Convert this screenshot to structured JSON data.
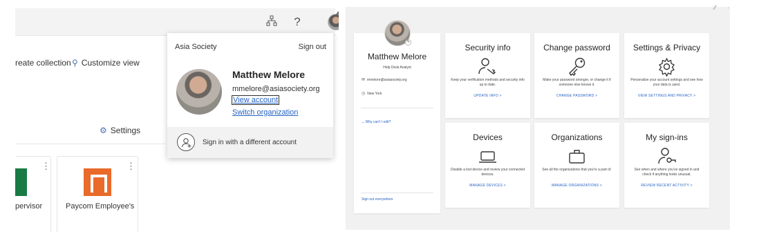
{
  "left_panel": {
    "toolbar": {
      "org_chart_icon": "org-chart-icon",
      "help_icon": "?",
      "avatar_icon": "avatar"
    },
    "actions": {
      "create_collection": "reate collection",
      "customize_view": "Customize view",
      "settings": "Settings"
    },
    "apps": [
      {
        "name": "pervisor",
        "icon": "green-app-icon",
        "color": "#1a7a43"
      },
      {
        "name": "Paycom Employee's",
        "icon": "paycom-icon",
        "color": "#ea6a2a"
      }
    ],
    "more_icon": "⋮",
    "account_popup": {
      "organization": "Asia Society",
      "sign_out": "Sign out",
      "user_name": "Matthew Melore",
      "user_email": "mmelore@asiasociety.org",
      "view_account": "View account",
      "switch_organization": "Switch organization",
      "sign_in_different": "Sign in with a different account"
    }
  },
  "right_panel": {
    "profile": {
      "name": "Matthew Melore",
      "title": "Help Desk Analyst",
      "email": "mmelore@asiasociety.org",
      "location": "New York",
      "why_cant_i_edit": "Why can't I edit?",
      "sign_out_everywhere": "Sign out everywhere"
    },
    "cards": [
      {
        "title": "Security info",
        "icon": "security-key-person-icon",
        "description": "Keep your verification methods and security info up to date.",
        "link": "UPDATE INFO  >"
      },
      {
        "title": "Change password",
        "icon": "key-icon",
        "description": "Make your password stronger, or change it if someone else knows it.",
        "link": "CHANGE PASSWORD  >"
      },
      {
        "title": "Settings & Privacy",
        "icon": "gear-icon",
        "description": "Personalize your account settings and see how your data is used.",
        "link": "VIEW SETTINGS AND PRIVACY  >"
      },
      {
        "title": "Devices",
        "icon": "laptop-icon",
        "description": "Disable a lost device and review your connected devices.",
        "link": "MANAGE DEVICES  >"
      },
      {
        "title": "Organizations",
        "icon": "briefcase-icon",
        "description": "See all the organizations that you're a part of.",
        "link": "MANAGE ORGANIZATIONS  >"
      },
      {
        "title": "My sign-ins",
        "icon": "person-key-icon",
        "description": "See when and where you've signed in and check if anything looks unusual.",
        "link": "REVIEW RECENT ACTIVITY  >"
      }
    ]
  },
  "colors": {
    "link_blue": "#2462c4",
    "panel_gray": "#f1f1f1",
    "paycom_orange": "#ea6a2a",
    "green_app": "#1a7a43"
  }
}
